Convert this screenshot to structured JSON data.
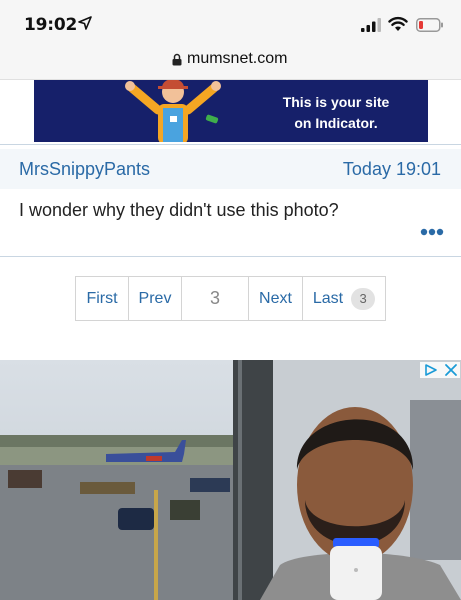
{
  "status_bar": {
    "time": "19:02",
    "icons": [
      "location-arrow-icon",
      "cellular-signal-icon",
      "wifi-icon",
      "low-battery-icon"
    ],
    "battery_color": "#e53935"
  },
  "browser": {
    "url": "mumsnet.com",
    "lock_icon": "lock-icon"
  },
  "ad_banner": {
    "line1": "This is your site",
    "line2": "on Indicator.",
    "background": "#16206a"
  },
  "post": {
    "author": "MrsSnippyPants",
    "time": "Today 19:01",
    "body": "I wonder why they didn't use this photo?",
    "accent": "#2a6aa6"
  },
  "pagination": {
    "first": "First",
    "prev": "Prev",
    "current": "3",
    "next": "Next",
    "last": "Last",
    "total": "3"
  },
  "video_ad": {
    "adchoices_icon": "adchoices-icon",
    "close_icon": "close-icon"
  }
}
